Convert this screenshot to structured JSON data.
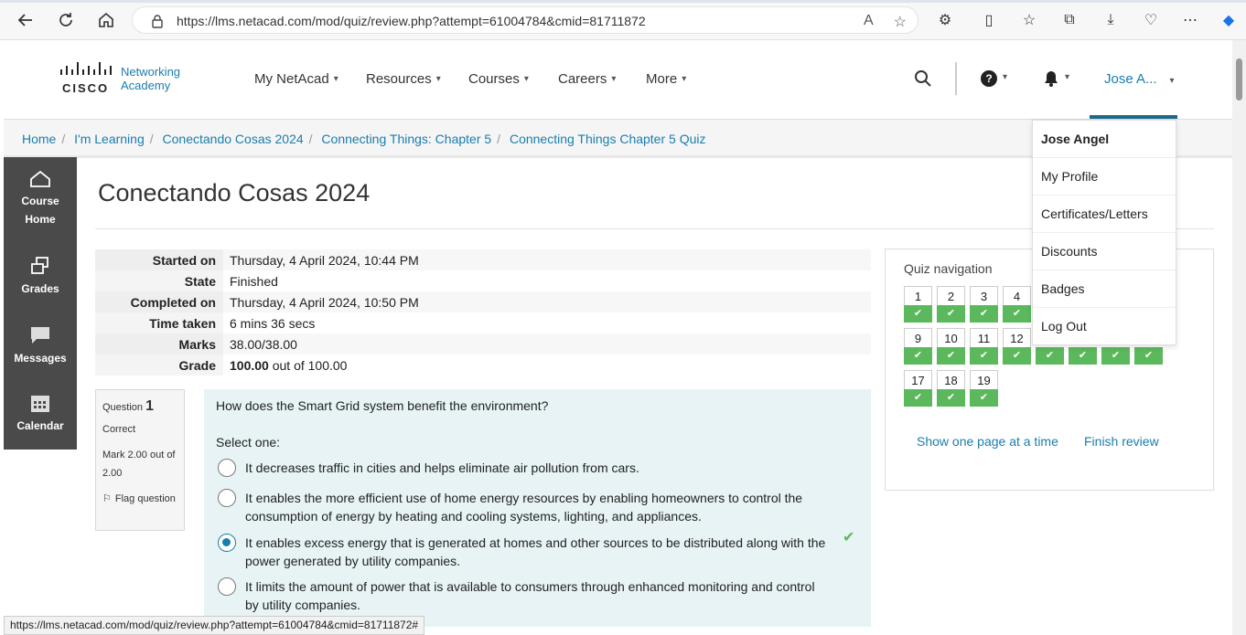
{
  "browser": {
    "url": "https://lms.netacad.com/mod/quiz/review.php?attempt=61004784&cmid=81711872"
  },
  "header": {
    "logo_line1": "Networking",
    "logo_line2": "Academy",
    "cisco": "CISCO",
    "nav": [
      "My NetAcad",
      "Resources",
      "Courses",
      "Careers",
      "More"
    ],
    "user_short": "Jose A..."
  },
  "breadcrumb": [
    "Home",
    "I'm Learning",
    "Conectando Cosas 2024",
    "Connecting Things: Chapter 5",
    "Connecting Things Chapter 5 Quiz"
  ],
  "sidebar": [
    {
      "line1": "Course",
      "line2": "Home"
    },
    {
      "line1": "Grades",
      "line2": ""
    },
    {
      "line1": "Messages",
      "line2": ""
    },
    {
      "line1": "Calendar",
      "line2": ""
    }
  ],
  "page_title": "Conectando Cosas 2024",
  "summary": [
    {
      "label": "Started on",
      "value": "Thursday, 4 April 2024, 10:44 PM"
    },
    {
      "label": "State",
      "value": "Finished"
    },
    {
      "label": "Completed on",
      "value": "Thursday, 4 April 2024, 10:50 PM"
    },
    {
      "label": "Time taken",
      "value": "6 mins 36 secs"
    },
    {
      "label": "Marks",
      "value": "38.00/38.00"
    },
    {
      "label": "Grade",
      "value_bold": "100.00",
      "value_rest": " out of 100.00"
    }
  ],
  "question": {
    "label": "Question",
    "number": "1",
    "status": "Correct",
    "mark": "Mark 2.00 out of 2.00",
    "flag": "Flag question",
    "text": "How does the Smart Grid system benefit the environment?",
    "select_label": "Select one:",
    "answers": [
      "It decreases traffic in cities and helps eliminate air pollution from cars.",
      "It enables the more efficient use of home energy resources by enabling homeowners to control the consumption of energy by heating and cooling systems, lighting, and appliances.",
      "It enables excess energy that is generated at homes and other sources to be distributed along with the power generated by utility companies.",
      "It limits the amount of power that is available to consumers through enhanced monitoring and control by utility companies."
    ],
    "selected_index": 2
  },
  "quiz_nav": {
    "title": "Quiz navigation",
    "show_one_page": "Show one page at a time",
    "finish_review": "Finish review",
    "buttons_visible": [
      "1",
      "2",
      "3",
      "4",
      "9",
      "10",
      "11",
      "12",
      "17",
      "18",
      "19"
    ]
  },
  "user_menu": [
    "Jose Angel",
    "My Profile",
    "Certificates/Letters",
    "Discounts",
    "Badges",
    "Log Out"
  ],
  "status_url": "https://lms.netacad.com/mod/quiz/review.php?attempt=61004784&cmid=81711872#"
}
